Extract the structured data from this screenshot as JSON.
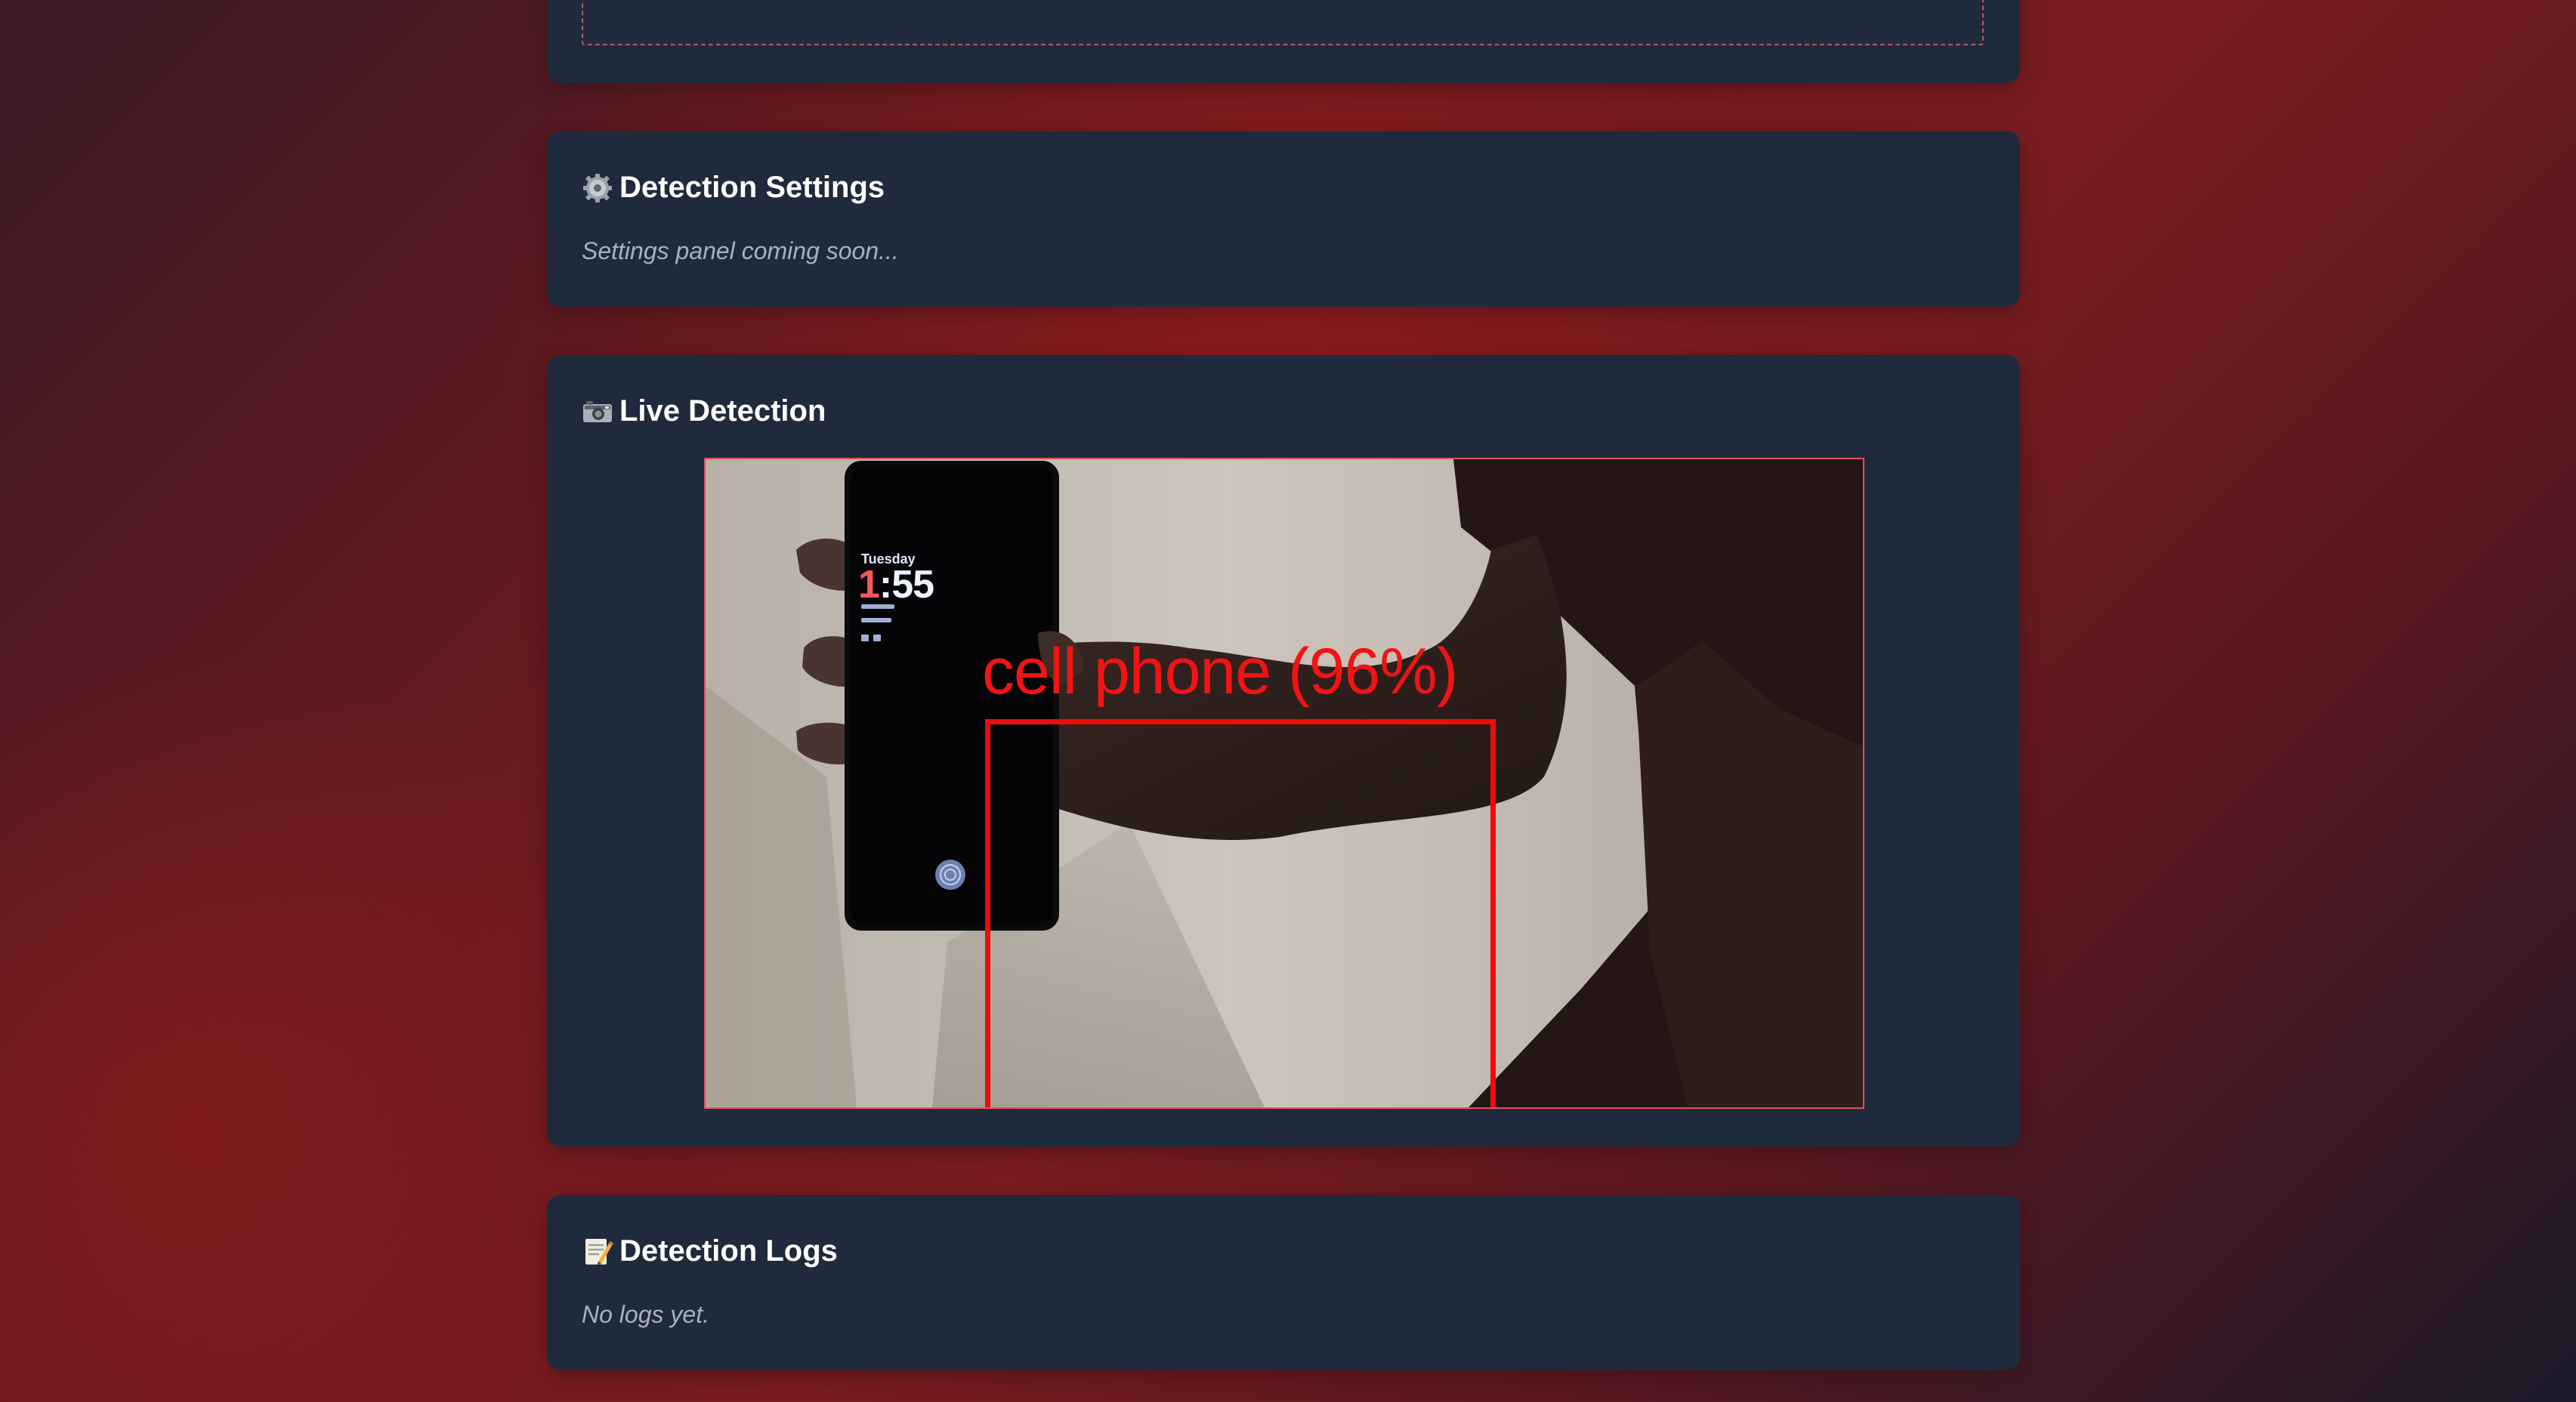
{
  "sections": {
    "settings": {
      "icon": "gear-icon",
      "title": "Detection Settings",
      "note": "Settings panel coming soon..."
    },
    "live": {
      "icon": "camera-icon",
      "title": "Live Detection",
      "detection": {
        "label": "cell phone (96%)",
        "color": "#f00a0a"
      },
      "phone_screen": {
        "day": "Tuesday",
        "time_first": "1",
        "time_rest": ":55"
      }
    },
    "logs": {
      "icon": "memo-icon",
      "title": "Detection Logs",
      "note": "No logs yet."
    }
  },
  "colors": {
    "card_bg": "#1f2a3c",
    "accent": "#e0525e",
    "text": "#ffffff",
    "muted": "#a8b1c0"
  }
}
